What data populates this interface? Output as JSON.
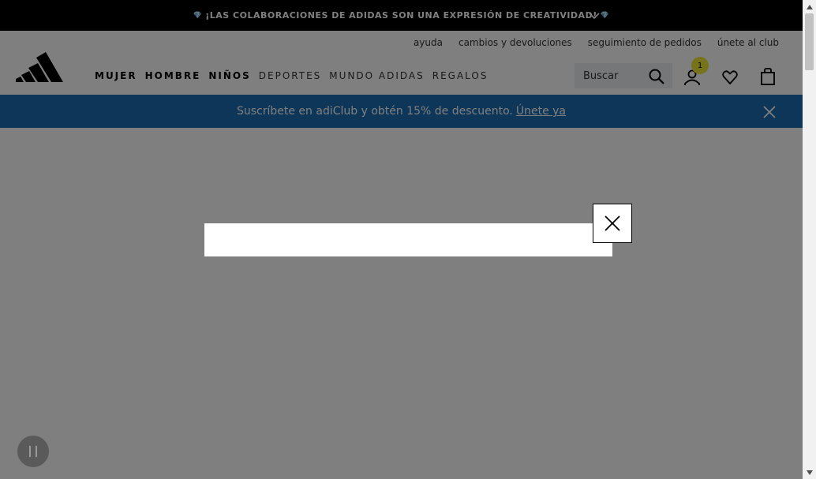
{
  "announcement": {
    "gem_left": "💎",
    "text": "¡LAS COLABORACIONES DE ADIDAS SON UNA EXPRESIÓN DE CREATIVIDAD!",
    "gem_right": "💎"
  },
  "utility_links": [
    "ayuda",
    "cambios y devoluciones",
    "seguimiento de pedidos",
    "únete al club"
  ],
  "nav": {
    "items": [
      "MUJER",
      "HOMBRE",
      "NIÑOS",
      "DEPORTES",
      "MUNDO ADIDAS",
      "REGALOS"
    ]
  },
  "search": {
    "placeholder": "Buscar"
  },
  "account": {
    "badge_count": "1"
  },
  "promo": {
    "text": "Suscríbete en adiClub y obtén 15% de descuento.",
    "link": "Únete ya",
    "background": "#1c6cb1"
  },
  "icons": {
    "logo": "adidas-logo",
    "announcement_toggle": "chevron-down-icon",
    "search": "search-icon",
    "account": "user-icon",
    "wishlist": "heart-icon",
    "bag": "shopping-bag-icon",
    "promo_close": "close-icon",
    "modal_close": "close-icon",
    "pause": "pause-icon"
  },
  "colors": {
    "badge": "#ede734",
    "overlay": "rgba(0,0,0,0.5)"
  }
}
